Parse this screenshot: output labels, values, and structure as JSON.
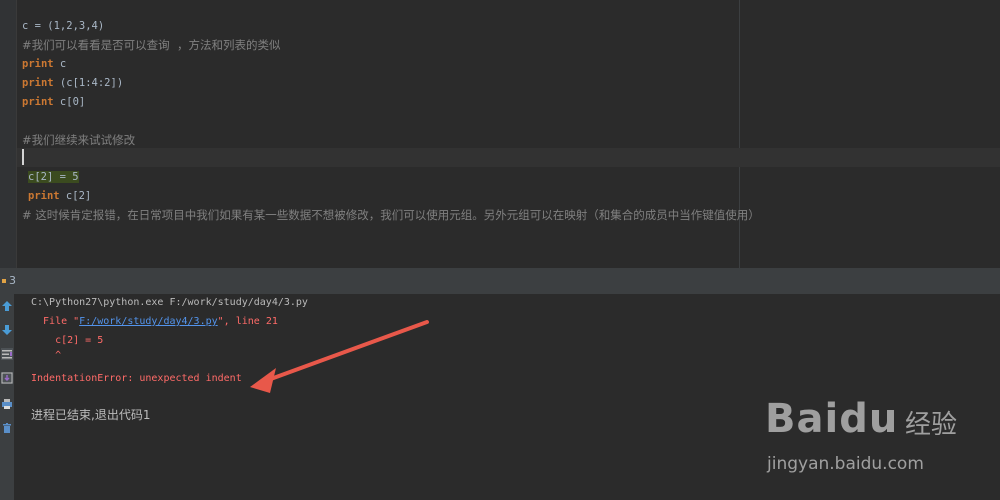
{
  "editor": {
    "lines": {
      "tuple_def": "c = (1,2,3,4)",
      "comment1": "#我们可以看看是否可以查询  ，方法和列表的类似",
      "print_c_kw": "print",
      "print_c_arg": " c",
      "print_slice_kw": "print",
      "print_slice_arg": " (c[1:4:2])",
      "print_index_kw": "print",
      "print_index_arg": " c[0]",
      "comment2": "#我们继续来试试修改",
      "assign": "c[2] = 5",
      "print_c2_kw": "print",
      "print_c2_arg": " c[2]",
      "comment3": "# 这时候肯定报错，在日常项目中我们如果有某一些数据不想被修改，我们可以使用元组。另外元组可以在映射（和集合的成员中当作键值使用）"
    }
  },
  "run_panel": {
    "tab_number": "3"
  },
  "console": {
    "command": "C:\\Python27\\python.exe F:/work/study/day4/3.py",
    "file_prefix": "  File \"",
    "file_link": "F:/work/study/day4/3.py",
    "file_suffix": "\", line 21",
    "code_line": "    c[2] = 5",
    "caret_line": "    ^",
    "error": "IndentationError: unexpected indent",
    "exit_msg": "进程已结束,退出代码1"
  },
  "watermark": {
    "brand": "Baidu",
    "product": "经验",
    "url": "jingyan.baidu.com"
  },
  "colors": {
    "background": "#2b2b2b",
    "keyword": "#cc7832",
    "error": "#ff6b68",
    "link": "#5394ec",
    "arrow": "#e8584a"
  },
  "icons": [
    "up-arrow-icon",
    "down-arrow-icon",
    "soft-wrap-icon",
    "scroll-to-end-icon",
    "print-icon",
    "trash-icon"
  ]
}
